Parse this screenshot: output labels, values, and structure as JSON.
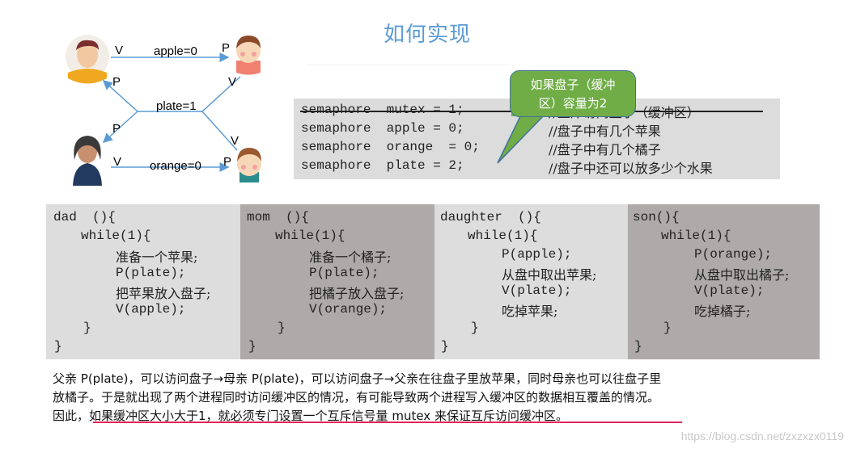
{
  "title": "如何实现",
  "diagram": {
    "nodes": [
      {
        "id": "dad",
        "role": "father",
        "avatar": "father-avatar"
      },
      {
        "id": "daughter",
        "role": "daughter",
        "avatar": "daughter-avatar"
      },
      {
        "id": "mom",
        "role": "mother",
        "avatar": "mother-avatar"
      },
      {
        "id": "son",
        "role": "son",
        "avatar": "son-avatar"
      }
    ],
    "labels": {
      "apple": "apple=0",
      "plate": "plate=1",
      "orange": "orange=0",
      "v": "V",
      "p": "P"
    }
  },
  "callout": {
    "line1": "如果盘子（缓冲",
    "line2": "区）容量为2"
  },
  "semaphores": [
    {
      "code": "semaphore  mutex = 1;",
      "comment": "//互斥访问盘子（缓冲区）",
      "struck": true
    },
    {
      "code": "semaphore  apple = 0;",
      "comment": "//盘子中有几个苹果",
      "struck": false
    },
    {
      "code": "semaphore  orange  = 0;",
      "comment": "//盘子中有几个橘子",
      "struck": false
    },
    {
      "code": "semaphore  plate = 2;",
      "comment": "//盘子中还可以放多少个水果",
      "struck": false
    }
  ],
  "processes": [
    {
      "name": "dad  (){",
      "loop": "while(1){",
      "lines": [
        "准备一个苹果;",
        "P(plate);",
        "把苹果放入盘子;",
        "V(apple);"
      ],
      "close_inner": "}",
      "close_outer": "}"
    },
    {
      "name": "mom  (){",
      "loop": "while(1){",
      "lines": [
        "准备一个橘子;",
        "P(plate);",
        "把橘子放入盘子;",
        "V(orange);"
      ],
      "close_inner": "}",
      "close_outer": "}"
    },
    {
      "name": "daughter  (){",
      "loop": "while(1){",
      "lines": [
        "P(apple);",
        "从盘中取出苹果;",
        "V(plate);",
        "吃掉苹果;"
      ],
      "close_inner": "}",
      "close_outer": "}"
    },
    {
      "name": "son(){",
      "loop": "while(1){",
      "lines": [
        "P(orange);",
        "从盘中取出橘子;",
        "V(plate);",
        "吃掉橘子;"
      ],
      "close_inner": "}",
      "close_outer": "}"
    }
  ],
  "paragraph": {
    "line1": "父亲 P(plate)，可以访问盘子→母亲 P(plate)，可以访问盘子→父亲在往盘子里放苹果，同时母亲也可以往盘子里",
    "line2": "放橘子。于是就出现了两个进程同时访问缓冲区的情况，有可能导致两个进程写入缓冲区的数据相互覆盖的情况。",
    "line3_prefix": "因此，",
    "line3_highlight": "如果缓冲区大小大于1，就必须专门设置一个互斥信号量  mutex 来保证互斥访问缓冲区。"
  },
  "colors": {
    "title": "#5b9bd5",
    "arrow": "#5b9bd5",
    "callout_fill": "#70ad47",
    "underline": "#e0245e"
  },
  "watermark": "https://blog.csdn.net/zxzxzx0119"
}
